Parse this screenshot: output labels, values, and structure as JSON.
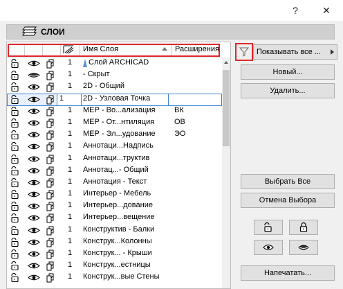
{
  "window": {
    "help_glyph": "?",
    "close_glyph": "✕"
  },
  "header": {
    "title": "СЛОИ"
  },
  "columns": {
    "name": "Имя Слоя",
    "extension": "Расширения"
  },
  "rows": [
    {
      "num": "1",
      "name": "Слой ARCHICAD",
      "ext": "",
      "eye": "open",
      "has_color_mark": true
    },
    {
      "num": "1",
      "name": "- Скрыт",
      "ext": "",
      "eye": "closed"
    },
    {
      "num": "1",
      "name": "2D - Общий",
      "ext": "",
      "eye": "open"
    },
    {
      "num": "1",
      "name": "2D - Узловая Точка",
      "ext": "",
      "eye": "open",
      "selected": true
    },
    {
      "num": "1",
      "name": "МЕР - Во...ализация",
      "ext": "ВК",
      "eye": "open"
    },
    {
      "num": "1",
      "name": "МЕР - От...нтиляция",
      "ext": "ОВ",
      "eye": "open"
    },
    {
      "num": "1",
      "name": "МЕР - Эл...удование",
      "ext": "ЭО",
      "eye": "open"
    },
    {
      "num": "1",
      "name": "Аннотаци...Надпись",
      "ext": "",
      "eye": "open"
    },
    {
      "num": "1",
      "name": "Аннотаци...труктив",
      "ext": "",
      "eye": "open"
    },
    {
      "num": "1",
      "name": "Аннотац...- Общий",
      "ext": "",
      "eye": "open"
    },
    {
      "num": "1",
      "name": "Аннотация - Текст",
      "ext": "",
      "eye": "open"
    },
    {
      "num": "1",
      "name": "Интерьер - Мебель",
      "ext": "",
      "eye": "open"
    },
    {
      "num": "1",
      "name": "Интерьер...дование",
      "ext": "",
      "eye": "open"
    },
    {
      "num": "1",
      "name": "Интерьер...вещение",
      "ext": "",
      "eye": "open"
    },
    {
      "num": "1",
      "name": "Конструктив - Балки",
      "ext": "",
      "eye": "open"
    },
    {
      "num": "1",
      "name": "Конструк...Колонны",
      "ext": "",
      "eye": "open"
    },
    {
      "num": "1",
      "name": "Конструк... - Крыши",
      "ext": "",
      "eye": "open"
    },
    {
      "num": "1",
      "name": "Конструк...естницы",
      "ext": "",
      "eye": "open"
    },
    {
      "num": "1",
      "name": "Конструк...вые Стены",
      "ext": "",
      "eye": "open"
    }
  ],
  "panel": {
    "show_label": "Показывать все ...",
    "new_label": "Новый...",
    "delete_label": "Удалить...",
    "select_all_label": "Выбрать Все",
    "deselect_label": "Отмена Выбора",
    "print_label": "Напечатать..."
  },
  "colors": {
    "highlight_red": "#e0262a",
    "selection_blue": "#3c84d4"
  }
}
